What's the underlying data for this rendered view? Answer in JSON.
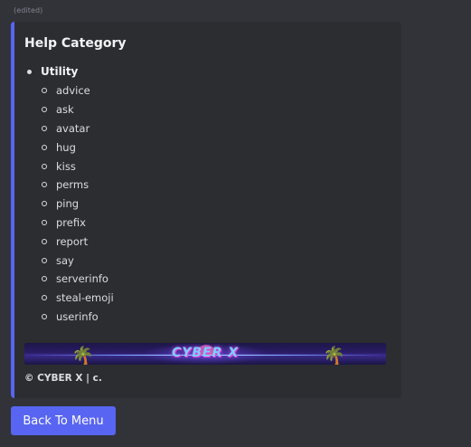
{
  "message": {
    "edited_label": "(edited)"
  },
  "embed": {
    "accent_color": "#5865f2",
    "title": "Help Category",
    "section": "Utility",
    "commands": [
      "advice",
      "ask",
      "avatar",
      "hug",
      "kiss",
      "perms",
      "ping",
      "prefix",
      "report",
      "say",
      "serverinfo",
      "steal-emoji",
      "userinfo"
    ],
    "banner_text": "CYBER X",
    "footer": "© CYBER X | c."
  },
  "buttons": {
    "back_label": "Back To Menu",
    "color": "#5865f2"
  }
}
